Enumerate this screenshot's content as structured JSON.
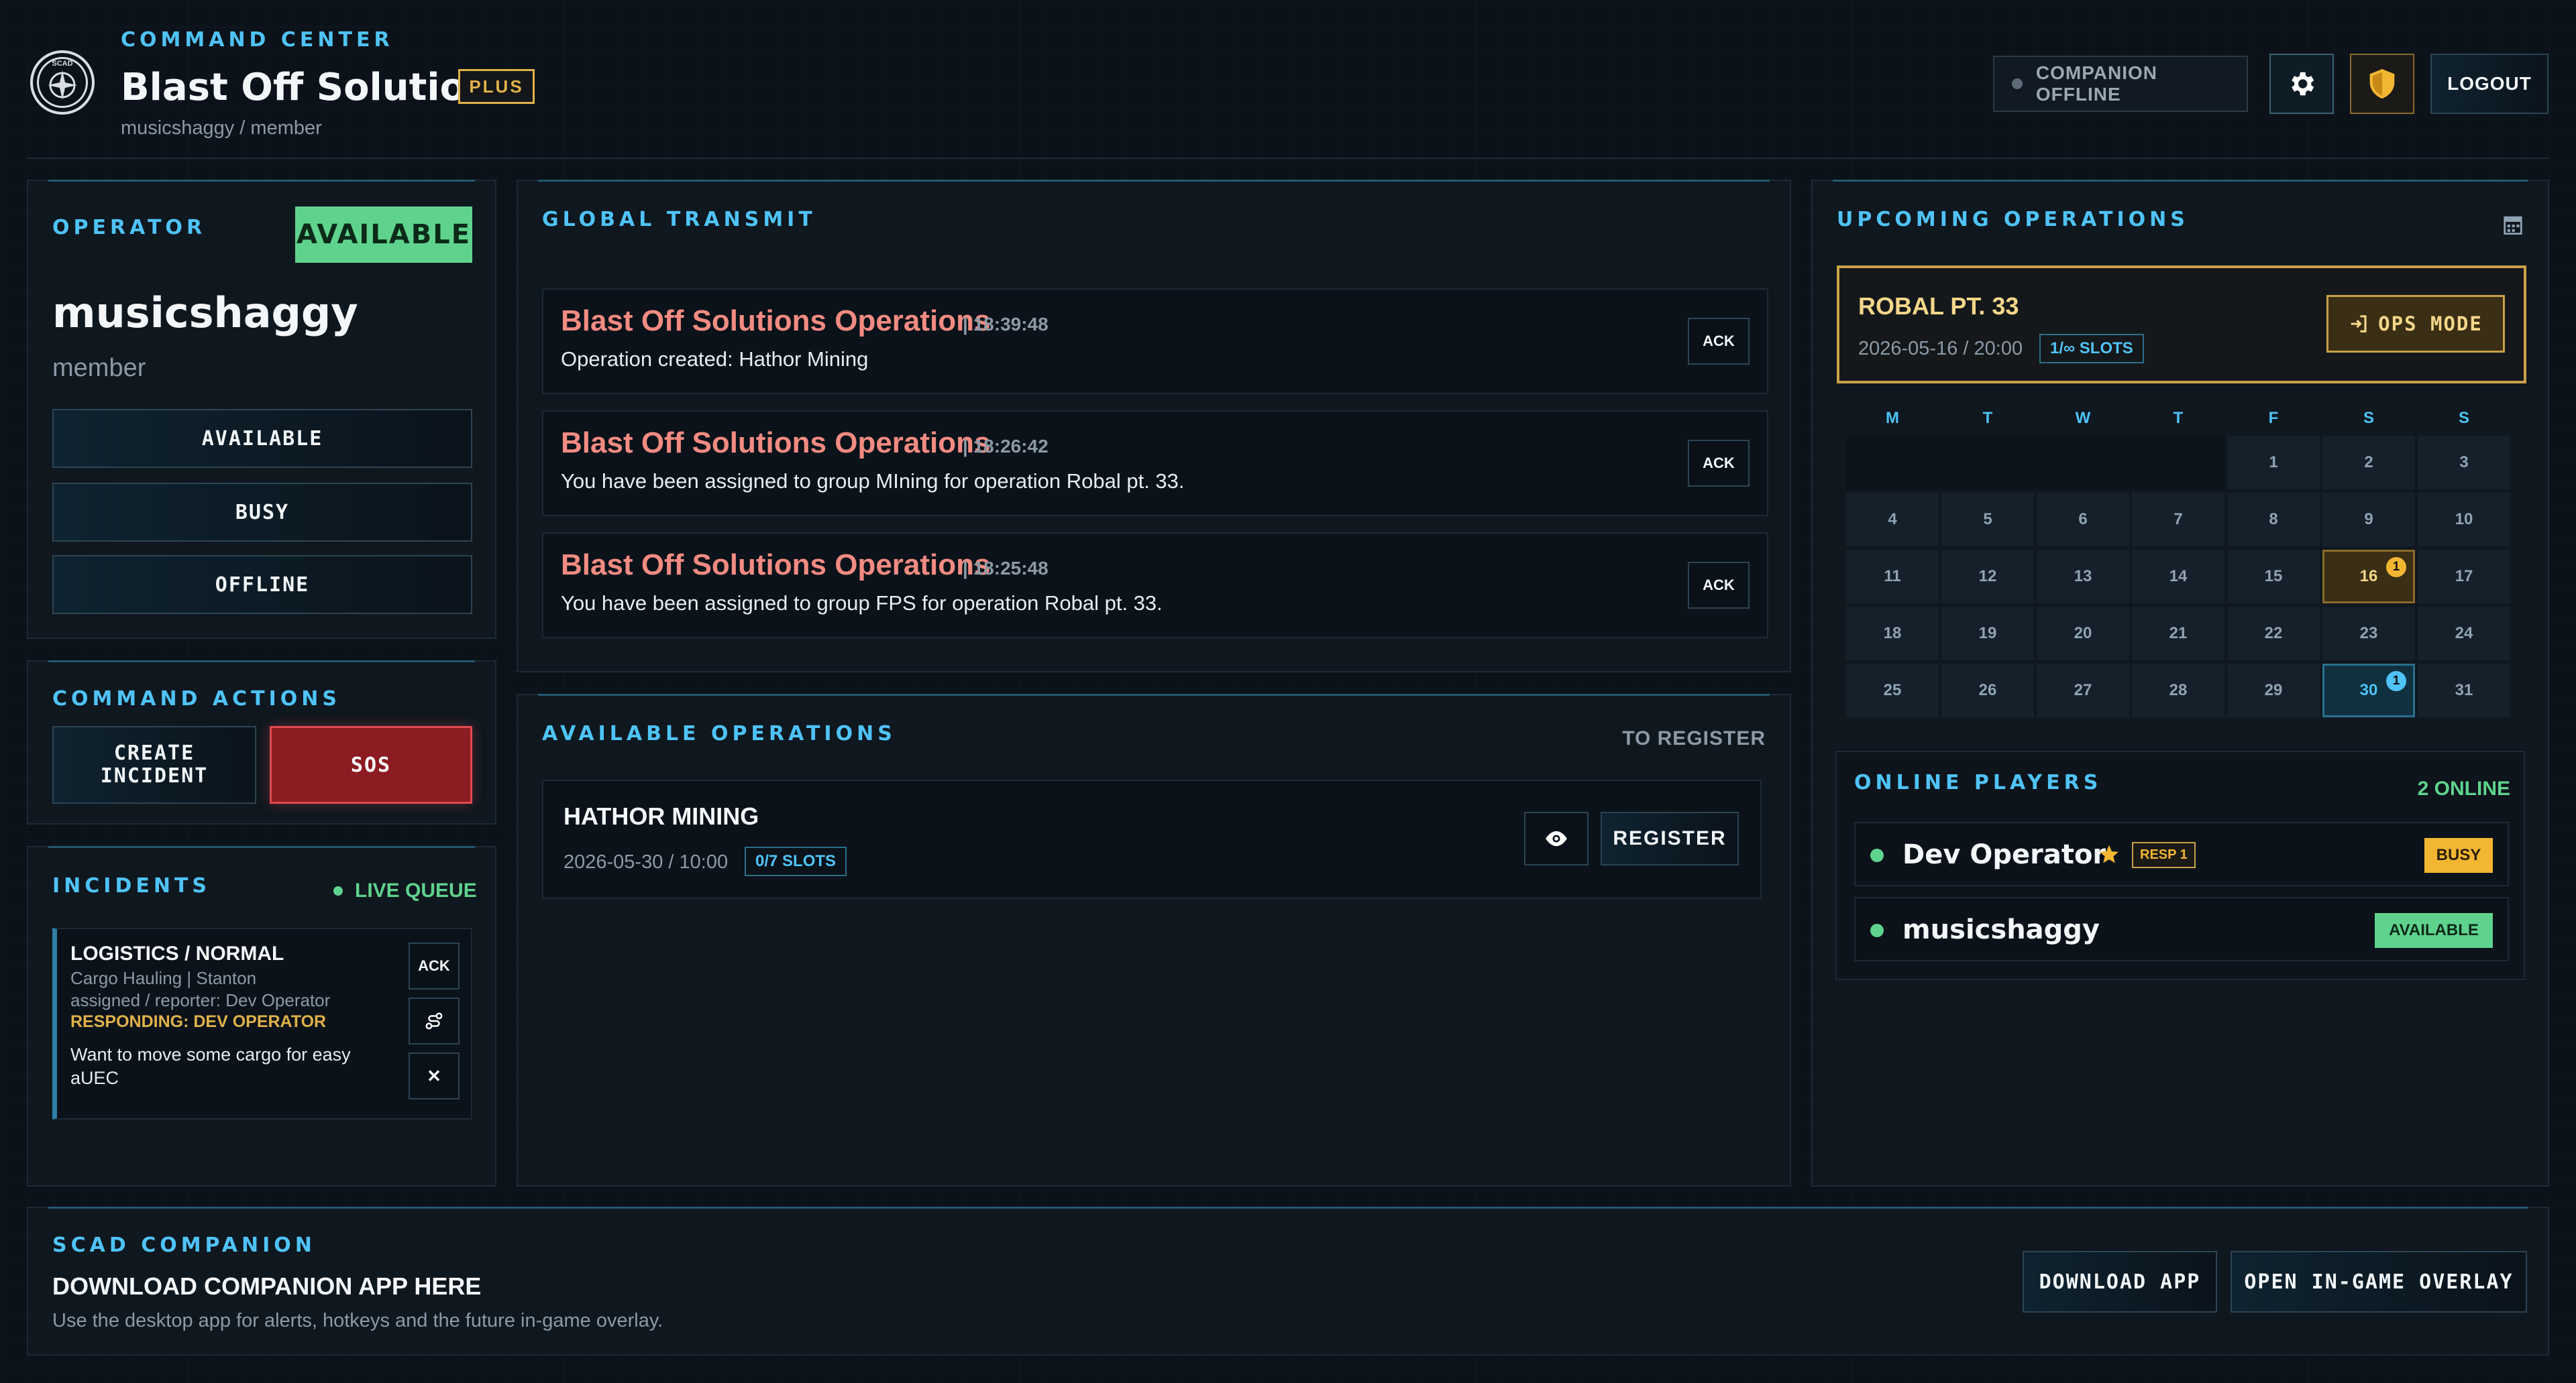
{
  "header": {
    "logo_text": "SCAD",
    "section_label": "COMMAND CENTER",
    "org_name": "Blast Off Solutions",
    "tier_badge": "PLUS",
    "user_path": "musicshaggy / member",
    "companion_status": "COMPANION OFFLINE",
    "logout_label": "LOGOUT"
  },
  "operator": {
    "heading": "OPERATOR",
    "status_badge": "AVAILABLE",
    "username": "musicshaggy",
    "role": "member",
    "status_buttons": [
      "AVAILABLE",
      "BUSY",
      "OFFLINE"
    ]
  },
  "command_actions": {
    "heading": "COMMAND ACTIONS",
    "create_incident": "CREATE\nINCIDENT",
    "sos": "SOS"
  },
  "incidents": {
    "heading": "INCIDENTS",
    "live_label": "LIVE QUEUE",
    "items": [
      {
        "title": "LOGISTICS / NORMAL",
        "line1": "Cargo Hauling | Stanton",
        "line2": "assigned / reporter: Dev Operator",
        "responding": "RESPONDING: DEV OPERATOR",
        "description": "Want to move some cargo for easy aUEC",
        "ack_label": "ACK",
        "close_label": "✕"
      }
    ]
  },
  "global_transmit": {
    "heading": "GLOBAL TRANSMIT",
    "ack_label": "ACK",
    "messages": [
      {
        "source": "Blast Off Solutions Operations",
        "time": "| 18:39:48",
        "text": "Operation created: Hathor Mining"
      },
      {
        "source": "Blast Off Solutions Operations",
        "time": "| 18:26:42",
        "text": "You have been assigned to group MIning for operation Robal pt. 33."
      },
      {
        "source": "Blast Off Solutions Operations",
        "time": "| 18:25:48",
        "text": "You have been assigned to group FPS for operation Robal pt. 33."
      }
    ]
  },
  "available_operations": {
    "heading": "AVAILABLE OPERATIONS",
    "subheading": "TO REGISTER",
    "items": [
      {
        "name": "HATHOR MINING",
        "datetime": "2026-05-30 / 10:00",
        "slots": "0/7 SLOTS",
        "register_label": "REGISTER"
      }
    ]
  },
  "upcoming_operations": {
    "heading": "UPCOMING OPERATIONS",
    "featured": {
      "name": "ROBAL PT. 33",
      "datetime": "2026-05-16 / 20:00",
      "slots": "1/∞ SLOTS",
      "ops_mode_label": "OPS MODE"
    },
    "calendar": {
      "days_of_week": [
        "M",
        "T",
        "W",
        "T",
        "F",
        "S",
        "S"
      ],
      "leading_blanks": 4,
      "days": [
        "1",
        "2",
        "3",
        "4",
        "5",
        "6",
        "7",
        "8",
        "9",
        "10",
        "11",
        "12",
        "13",
        "14",
        "15",
        "16",
        "17",
        "18",
        "19",
        "20",
        "21",
        "22",
        "23",
        "24",
        "25",
        "26",
        "27",
        "28",
        "29",
        "30",
        "31"
      ],
      "events": [
        {
          "day": "16",
          "count": "1",
          "style": "gold"
        },
        {
          "day": "30",
          "count": "1",
          "style": "blue"
        }
      ]
    }
  },
  "online_players": {
    "heading": "ONLINE PLAYERS",
    "count_label": "2 ONLINE",
    "players": [
      {
        "name": "Dev Operator",
        "role_badge": "RESP 1",
        "status": "BUSY",
        "starred": true
      },
      {
        "name": "musicshaggy",
        "role_badge": "",
        "status": "AVAILABLE",
        "starred": false
      }
    ]
  },
  "companion": {
    "heading": "SCAD COMPANION",
    "title": "DOWNLOAD COMPANION APP HERE",
    "description": "Use the desktop app for alerts, hotkeys and the future in-game overlay.",
    "download_label": "DOWNLOAD APP",
    "overlay_label": "OPEN IN-GAME OVERLAY"
  },
  "colors": {
    "accent_cyan": "#4fc3f7",
    "alert_red": "#f28b82",
    "available_green": "#5fd38d",
    "gold": "#e0b24a",
    "sos_red": "#8c1c22"
  },
  "icons": [
    "logo-emblem",
    "gear-icon",
    "shield-icon",
    "calendar-icon",
    "eye-icon",
    "login-icon",
    "star-icon",
    "incident-route-icon",
    "close-icon"
  ]
}
